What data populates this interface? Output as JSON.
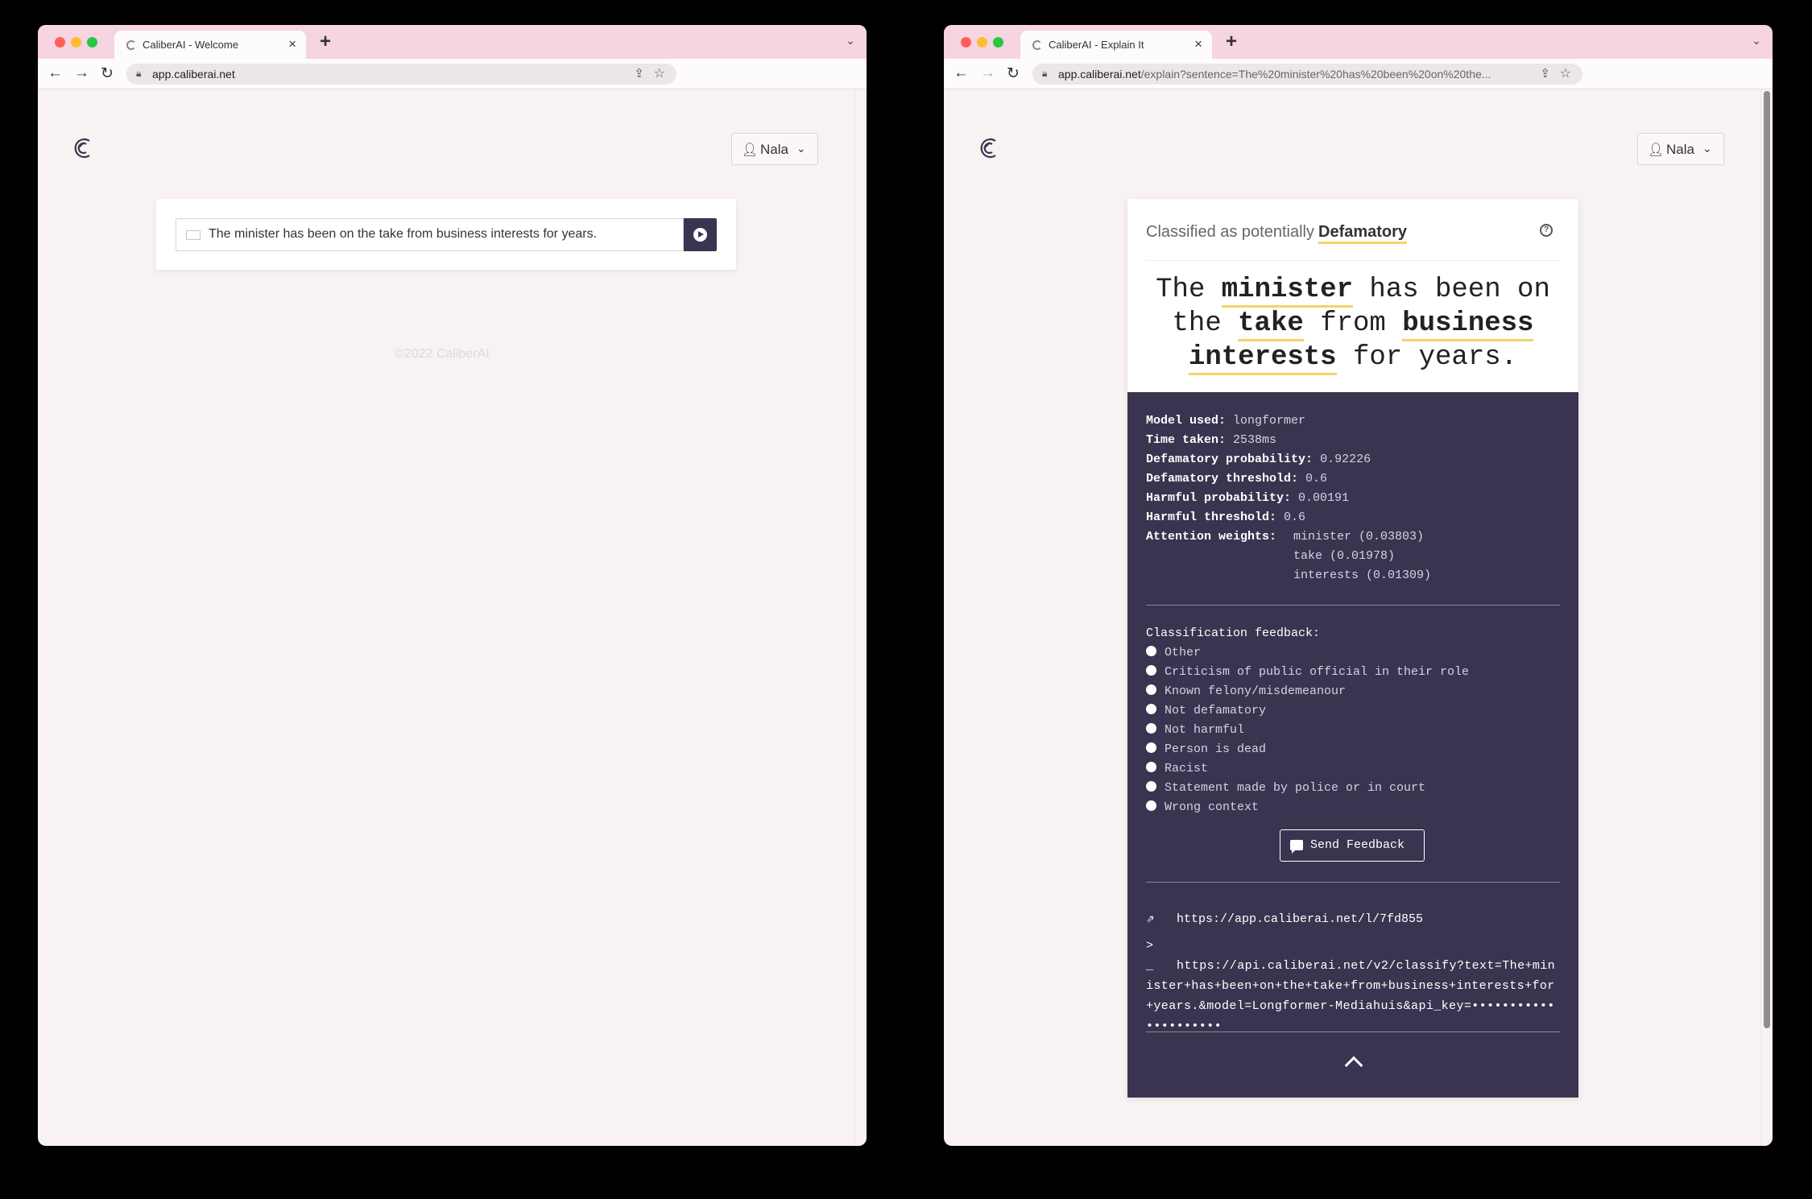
{
  "left_window": {
    "tab_title": "CaliberAI - Welcome",
    "url": "app.caliberai.net",
    "user": "Nala",
    "search_text": "The minister has been on the take from business interests for years.",
    "copyright": "©2022 CaliberAI"
  },
  "right_window": {
    "tab_title": "CaliberAI - Explain It",
    "url_host": "app.caliberai.net",
    "url_rest": "/explain?sentence=The%20minister%20has%20been%20on%20the...",
    "user": "Nala",
    "classified_label": "Classified as potentially",
    "classified_tag": "Defamatory",
    "sentence": {
      "w1": "The",
      "w2": "minister",
      "w3": "has been on",
      "w4": "the",
      "w5": "take",
      "w6": "from",
      "w7": "business",
      "w8": "interests",
      "w9": "for years."
    },
    "details": {
      "model_k": "Model used",
      "model_v": "longformer",
      "time_k": "Time taken",
      "time_v": "2538ms",
      "dprob_k": "Defamatory probability",
      "dprob_v": "0.92226",
      "dthr_k": "Defamatory threshold",
      "dthr_v": "0.6",
      "hprob_k": "Harmful probability",
      "hprob_v": "0.00191",
      "hthr_k": "Harmful threshold",
      "hthr_v": "0.6",
      "attn_k": "Attention weights",
      "attn": [
        "minister (0.03803)",
        "take (0.01978)",
        "interests (0.01309)"
      ]
    },
    "feedback": {
      "title": "Classification feedback:",
      "options": [
        "Other",
        "Criticism of public official in their role",
        "Known felony/misdemeanour",
        "Not defamatory",
        "Not harmful",
        "Person is dead",
        "Racist",
        "Statement made by police or in court",
        "Wrong context"
      ],
      "send_label": "Send Feedback"
    },
    "share_link": "https://app.caliberai.net/l/7fd855",
    "api_link": "https://api.caliberai.net/v2/classify?text=The+minister+has+been+on+the+take+from+business+interests+for+years.&model=Longformer-Mediahuis&api_key=•••••••••••••••••••••"
  },
  "colors": {
    "tabbar": "#f6d4e2",
    "page_bg": "#f8f2f2",
    "accent_dark": "#3a3450",
    "highlight": "#f3d36b"
  }
}
